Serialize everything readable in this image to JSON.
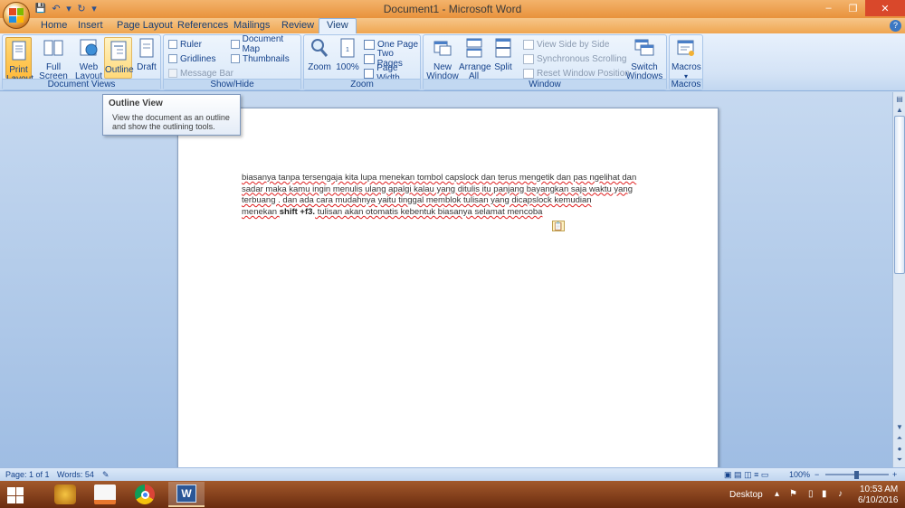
{
  "window": {
    "title": "Document1 - Microsoft Word",
    "minimize": "–",
    "restore": "❐",
    "close": "✕"
  },
  "qat": {
    "save": "💾",
    "undo": "↶",
    "redo": "↻",
    "customize": "▾"
  },
  "tabs": [
    {
      "label": "Home"
    },
    {
      "label": "Insert"
    },
    {
      "label": "Page Layout"
    },
    {
      "label": "References"
    },
    {
      "label": "Mailings"
    },
    {
      "label": "Review"
    },
    {
      "label": "View"
    }
  ],
  "ribbon": {
    "document_views": {
      "label": "Document Views",
      "print_layout": "Print Layout",
      "full_screen": "Full Screen Reading",
      "web_layout": "Web Layout",
      "outline": "Outline",
      "draft": "Draft"
    },
    "show_hide": {
      "label": "Show/Hide",
      "ruler": "Ruler",
      "gridlines": "Gridlines",
      "message_bar": "Message Bar",
      "document_map": "Document Map",
      "thumbnails": "Thumbnails"
    },
    "zoom": {
      "label": "Zoom",
      "zoom": "Zoom",
      "hundred": "100%",
      "one_page": "One Page",
      "two_pages": "Two Pages",
      "page_width": "Page Width"
    },
    "window": {
      "label": "Window",
      "new_window": "New Window",
      "arrange_all": "Arrange All",
      "split": "Split",
      "view_side": "View Side by Side",
      "sync_scroll": "Synchronous Scrolling",
      "reset_pos": "Reset Window Position",
      "switch_windows": "Switch Windows ▾"
    },
    "macros": {
      "label": "Macros",
      "macros": "Macros"
    }
  },
  "tooltip": {
    "title": "Outline View",
    "description": "View the document as an outline and show the outlining tools."
  },
  "document": {
    "w1": "biasanya tanpa tersengaja kita lupa menekan tombol capslock dan terus mengetik dan pas ngelihat dan",
    "w2": "sadar maka kamu ingin menulis ulang apalgi kalau yang ditulis itu panjang bayangkan saja waktu yang",
    "w3": "terbuang . dan ada cara mudahnya yaitu tinggal memblok tulisan yang dicapslock kemudian",
    "w4a": "menekan ",
    "w4b": "shift +f3.",
    "w4c": " tulisan akan otomatis kebentuk biasanya selamat  mencoba"
  },
  "status": {
    "page": "Page: 1 of 1",
    "words": "Words: 54",
    "zoom": "100%",
    "zoom_out": "−",
    "zoom_in": "+"
  },
  "taskbar": {
    "desktop": "Desktop",
    "time": "10:53 AM",
    "date": "6/10/2016"
  }
}
